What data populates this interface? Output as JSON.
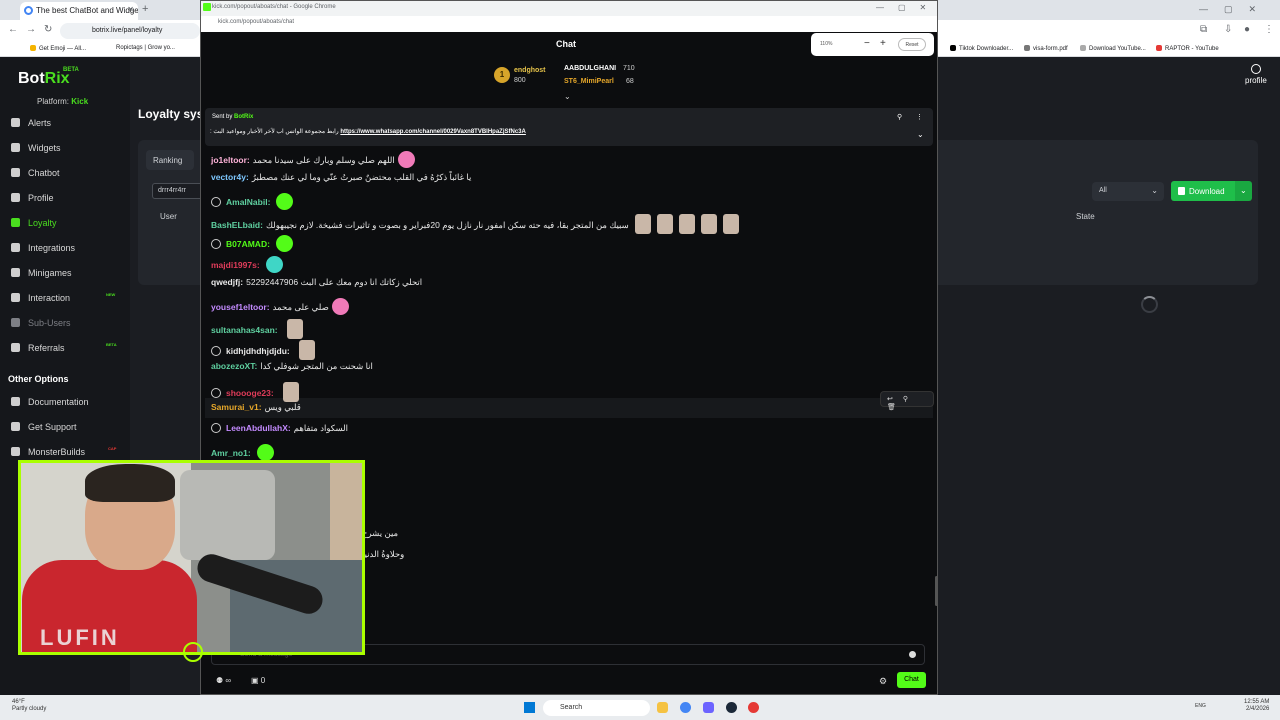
{
  "main_window": {
    "tab_title": "The best ChatBot and Widgets",
    "url": "botrix.live/panel/loyalty",
    "bookmarks": [
      "Get Emoji — All...",
      "Ropictags | Grow yo...",
      "Tiktok Downloader...",
      "visa-form.pdf",
      "Download YouTube...",
      "RAPTOR - YouTube"
    ]
  },
  "botrix": {
    "logo_main": "Bot",
    "logo_accent": "Rix",
    "beta": "BETA",
    "platform_label": "Platform:",
    "platform_value": "Kick",
    "nav": [
      {
        "label": "Alerts"
      },
      {
        "label": "Widgets"
      },
      {
        "label": "Chatbot"
      },
      {
        "label": "Profile"
      },
      {
        "label": "Loyalty",
        "active": true
      },
      {
        "label": "Integrations"
      },
      {
        "label": "Minigames"
      },
      {
        "label": "Interaction",
        "badge": "NEW"
      },
      {
        "label": "Sub-Users",
        "dim": true
      },
      {
        "label": "Referrals",
        "badge": "BETA"
      }
    ],
    "other_options_heading": "Other Options",
    "other_nav": [
      {
        "label": "Documentation"
      },
      {
        "label": "Get Support"
      },
      {
        "label": "MonsterBuilds",
        "badge": "CAP"
      }
    ],
    "page_title": "Loyalty sys",
    "ranking_tab": "Ranking",
    "search_value": "drrr4rr4rr",
    "column_user": "User",
    "column_state": "State",
    "filter_value": "All",
    "download_label": "Download",
    "profile_label": "profile",
    "badge_color_new": "#4ade1f",
    "badge_color_beta": "#4ade1f",
    "badge_color_cap": "#e53935"
  },
  "popup": {
    "window_title": "kick.com/popout/aboats/chat - Google Chrome",
    "url": "kick.com/popout/aboats/chat",
    "chat_title": "Chat",
    "zoom": {
      "percent": "110%",
      "minus": "−",
      "plus": "+",
      "reset": "Reset"
    },
    "leaderboard": {
      "rank": "1",
      "first_name": "endghost",
      "first_value": "800",
      "second_name": "AABDULGHANI",
      "second_value": "710",
      "third_name": "ST6_MimiPearl",
      "third_value": "68"
    },
    "pinned": {
      "sent_by_label": "Sent by",
      "sent_by_name": "BotRix",
      "message_prefix": ": رابط مجموعة الواتس اب لآخر الأخبار ومواعيد البث",
      "link": "https://www.whatsapp.com/channel/0029Vaxn8TVBlHpaZjSfNc3A"
    },
    "messages": [
      {
        "user": "jo1eltoor:",
        "text": "اللهم صلي وسلم وبارك على سيدنا محمد",
        "color": "#ffb3d9",
        "emote": "#f07ab8"
      },
      {
        "user": "vector4y:",
        "text": "يا غائباً ذكرُهُ في القلب محتضنٌ صبرتُ عنّي وما لي عنك مصطبرُ",
        "color": "#7ec8ff"
      },
      {
        "user": "AmalNabil:",
        "text": "",
        "color": "#5fd0a0",
        "emote": "#53fc18",
        "prefix": true
      },
      {
        "user": "BashELbaid:",
        "text": "سبيك من المتجر بقا، فيه حته سكن امفور نار نازل يوم 20فبراير و بصوت و تاثيرات فشيخة. لازم نجيبهولك",
        "color": "#5fd0a0",
        "faces": 5
      },
      {
        "user": "B07AMAD:",
        "text": "",
        "color": "#53fc18",
        "emote": "#53fc18",
        "prefix": true
      },
      {
        "user": "majdi1997s:",
        "text": "",
        "color": "#e03c5a",
        "emote": "#3fd6c6"
      },
      {
        "user": "qwedjfj:",
        "text": "اتحلي زكاتك انا دوم معك على البث 52292447906",
        "color": "#e8e8e8"
      },
      {
        "user": "yousef1eltoor:",
        "text": "صلي على محمد",
        "color": "#c48bff",
        "emote": "#f07ab8"
      },
      {
        "user": "sultanahas4san:",
        "text": "",
        "color": "#5fd0a0",
        "faces": 1
      },
      {
        "user": "kidhjdhdhjdjdu:",
        "text": "",
        "color": "#e8e8e8",
        "faces": 1,
        "prefix": true
      },
      {
        "user": "abozezoXT:",
        "text": "انا شحنت من المتجر شوفلي كدا",
        "color": "#5fd0a0"
      },
      {
        "user": "shoooge23:",
        "text": "",
        "color": "#e03c5a",
        "faces": 1,
        "prefix": true
      },
      {
        "user": "Samurai_v1:",
        "text": "قلبي ويس",
        "color": "#e6a72a"
      },
      {
        "user": "LeenAbdullahX:",
        "text": "السكواد متفاهم",
        "color": "#c48bff",
        "prefix": true
      },
      {
        "user": "Amr_no1:",
        "text": "",
        "color": "#5fd0a0",
        "emote": "#53fc18"
      }
    ],
    "hidden_fragments": [
      "مين يشرح",
      "وحلاوةُ الدنيا"
    ],
    "input_placeholder": "Send a message",
    "counter_a": "∞",
    "counter_b": "0",
    "send_label": "Chat"
  },
  "webcam": {
    "shirt_text": "LUFIN"
  },
  "taskbar": {
    "weather_temp": "46°F",
    "weather_desc": "Partly cloudy",
    "search_label": "Search",
    "tray_lang": "ENG",
    "time": "12:55 AM",
    "date": "2/4/2026"
  }
}
